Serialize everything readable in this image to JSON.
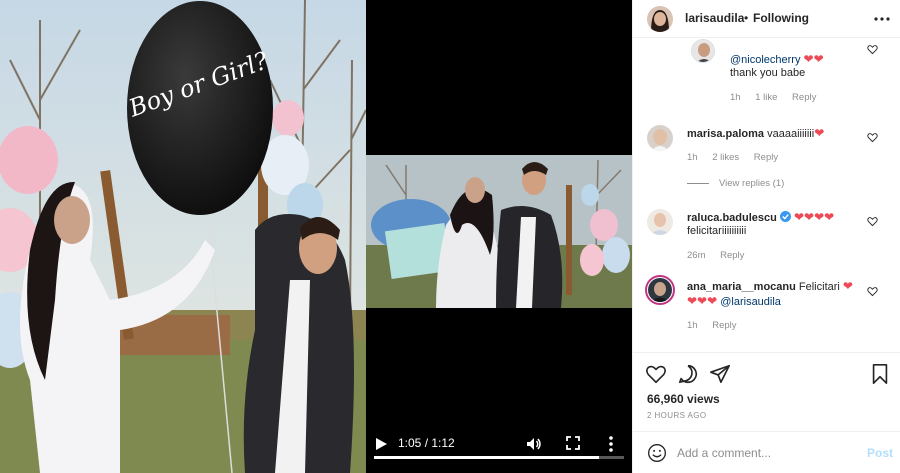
{
  "header": {
    "username": "larisaudila",
    "separator": "•",
    "follow_label": "Following",
    "more_icon": "more-horizontal-icon"
  },
  "photo": {
    "balloon_text": "Boy or Girl?",
    "balloon_small_text": "BOY"
  },
  "video": {
    "time_label": "1:05 / 1:12",
    "progress": 0.9,
    "play_icon": "play-icon",
    "volume_icon": "volume-icon",
    "fullscreen_icon": "fullscreen-icon",
    "more_icon": "more-vertical-icon"
  },
  "comments": [
    {
      "mention": "@nicolecherry",
      "text": "thank you babe",
      "hearts": "❤❤",
      "meta": {
        "time": "1h",
        "likes": "1 like",
        "reply": "Reply"
      }
    },
    {
      "username": "marisa.paloma",
      "text": "vaaaaiiiiiii",
      "hearts": "❤",
      "meta": {
        "time": "1h",
        "likes": "2 likes",
        "reply": "Reply"
      },
      "view_replies": "View replies (1)"
    },
    {
      "username": "raluca.badulescu",
      "hearts": "❤❤❤❤",
      "text": "felicitariiiiiiiiii",
      "meta": {
        "time": "26m",
        "reply": "Reply"
      }
    },
    {
      "username": "ana_maria__mocanu",
      "text": "Felicitari",
      "hearts": "❤",
      "hearts2": "❤❤❤",
      "mention": "@larisaudila",
      "meta": {
        "time": "1h",
        "reply": "Reply"
      }
    }
  ],
  "actions": {
    "views": "66,960 views",
    "time_ago": "2 HOURS AGO",
    "comment_placeholder": "Add a comment...",
    "post_label": "Post"
  },
  "colors": {
    "text": "#262626",
    "muted": "#8e8e8e",
    "link": "#00376b",
    "heart": "#ed4956",
    "post_disabled": "#b2dffc"
  }
}
